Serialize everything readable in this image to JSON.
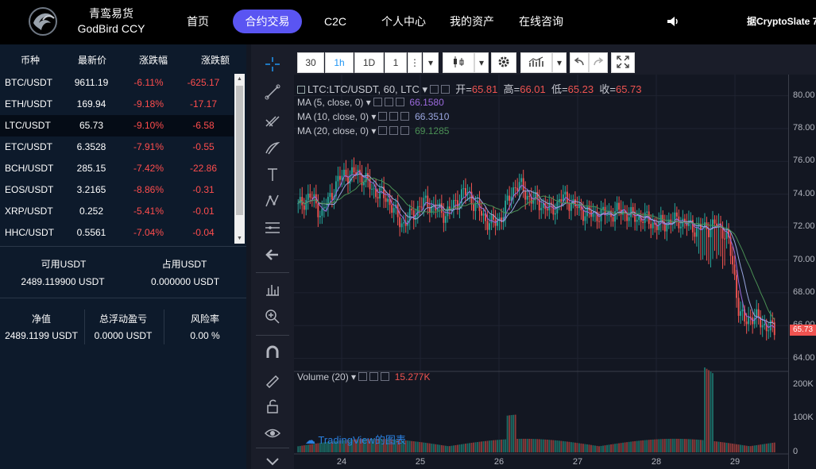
{
  "nav": {
    "brand_cn": "青鸾易货",
    "brand_en": "GodBird CCY",
    "items": [
      "首页",
      "合约交易",
      "C2C",
      "个人中心",
      "我的资产",
      "在线咨询"
    ],
    "active": "合约交易",
    "marquee": "据CryptoSlate 7"
  },
  "market": {
    "headers": [
      "币种",
      "最新价",
      "涨跌幅",
      "涨跌额"
    ],
    "rows": [
      {
        "symbol": "BTC/USDT",
        "price": "9611.19",
        "pct": "-6.11%",
        "chg": "-625.17"
      },
      {
        "symbol": "ETH/USDT",
        "price": "169.94",
        "pct": "-9.18%",
        "chg": "-17.17"
      },
      {
        "symbol": "LTC/USDT",
        "price": "65.73",
        "pct": "-9.10%",
        "chg": "-6.58"
      },
      {
        "symbol": "ETC/USDT",
        "price": "6.3528",
        "pct": "-7.91%",
        "chg": "-0.55"
      },
      {
        "symbol": "BCH/USDT",
        "price": "285.15",
        "pct": "-7.42%",
        "chg": "-22.86"
      },
      {
        "symbol": "EOS/USDT",
        "price": "3.2165",
        "pct": "-8.86%",
        "chg": "-0.31"
      },
      {
        "symbol": "XRP/USDT",
        "price": "0.252",
        "pct": "-5.41%",
        "chg": "-0.01"
      },
      {
        "symbol": "HHC/USDT",
        "price": "0.5561",
        "pct": "-7.04%",
        "chg": "-0.04"
      }
    ],
    "selected": "LTC/USDT"
  },
  "balance": {
    "available_label": "可用USDT",
    "available_value": "2489.119900 USDT",
    "occupied_label": "占用USDT",
    "occupied_value": "0.000000 USDT",
    "net_label": "净值",
    "net_value": "2489.1199 USDT",
    "pnl_label": "总浮动盈亏",
    "pnl_value": "0.0000 USDT",
    "risk_label": "风险率",
    "risk_value": "0.00 %"
  },
  "toolbar": {
    "minutes": "30",
    "interval_active": "1h",
    "interval_day": "1D",
    "count": "1"
  },
  "chart_legend": {
    "symbol": "LTC:LTC/USDT, 60, LTC",
    "open_label": "开=",
    "open": "65.81",
    "high_label": "高=",
    "high": "66.01",
    "low_label": "低=",
    "low": "65.23",
    "close_label": "收=",
    "close": "65.73",
    "ma5_label": "MA (5, close, 0)",
    "ma5": "66.1580",
    "ma10_label": "MA (10, close, 0)",
    "ma10": "66.3510",
    "ma20_label": "MA (20, close, 0)",
    "ma20": "69.1285",
    "volume_label": "Volume (20)",
    "volume": "15.277K",
    "last_price": "65.73",
    "watermark": "TradingView的图表"
  },
  "colors": {
    "up": "#26a69a",
    "down": "#ef5350",
    "ma5": "#9c6ade",
    "ma10": "#9aa6e0",
    "ma20": "#4a8f54",
    "accent": "#5a55f2"
  },
  "chart_data": {
    "type": "candlestick",
    "x_ticks": [
      "24",
      "25",
      "26",
      "27",
      "28",
      "29"
    ],
    "y_ticks": [
      "80.00",
      "78.00",
      "76.00",
      "74.00",
      "72.00",
      "70.00",
      "68.00",
      "66.00",
      "64.00"
    ],
    "volume_ticks": [
      "200K",
      "100K",
      "0"
    ],
    "ylim": [
      63.5,
      81.0
    ],
    "volume_max": 220000,
    "close_path": [
      73.2,
      73.6,
      73.9,
      73.4,
      72.8,
      73.5,
      74.3,
      74.9,
      75.3,
      75.1,
      75.4,
      75.0,
      74.6,
      74.2,
      74.0,
      73.8,
      73.2,
      72.5,
      72.2,
      72.6,
      73.0,
      73.4,
      73.5,
      73.2,
      73.0,
      72.8,
      73.1,
      73.6,
      74.1,
      74.0,
      73.4,
      72.9,
      72.4,
      72.2,
      72.4,
      72.9,
      73.9,
      74.6,
      74.4,
      73.9,
      73.6,
      73.5,
      73.2,
      73.0,
      73.4,
      73.8,
      73.6,
      73.3,
      73.0,
      72.9,
      72.7,
      72.8,
      72.8,
      72.8,
      72.9,
      73.0,
      72.8,
      72.6,
      72.6,
      72.5,
      72.3,
      72.1,
      72.2,
      72.3,
      72.4,
      72.4,
      72.2,
      72.0,
      71.9,
      71.9,
      72.0,
      72.1,
      71.9,
      71.4,
      69.5,
      66.8,
      66.2,
      66.6,
      66.4,
      66.1,
      65.9,
      65.7
    ]
  }
}
